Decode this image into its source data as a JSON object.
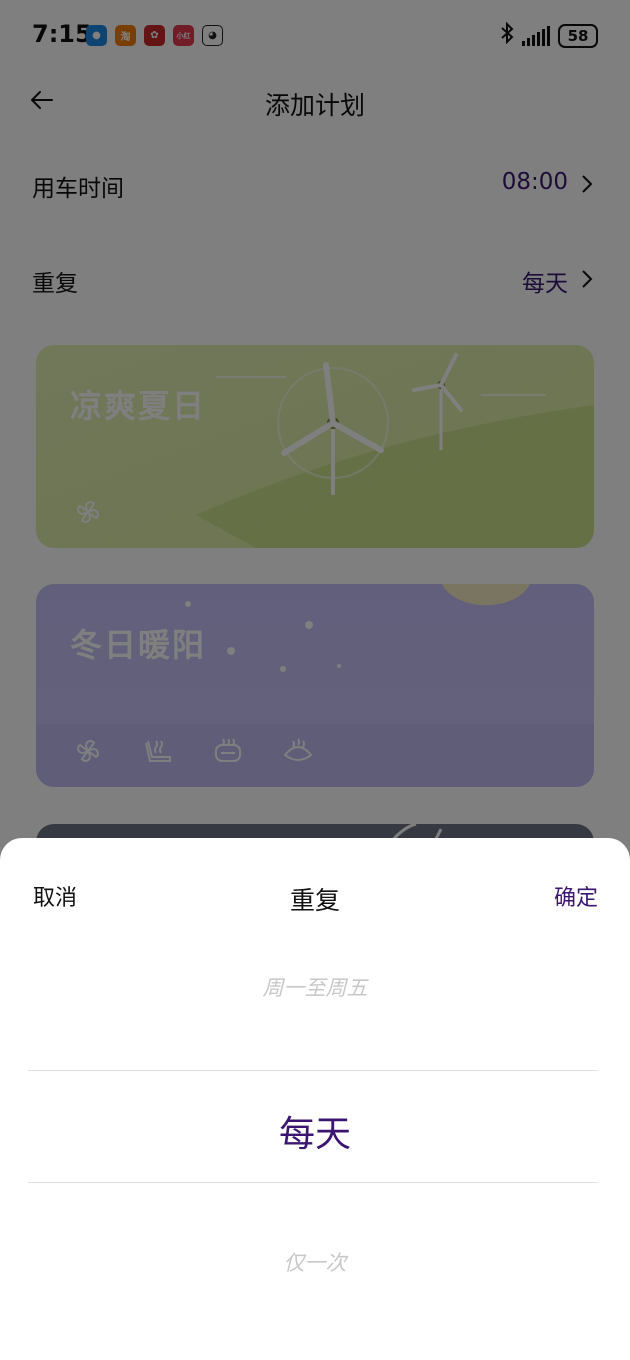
{
  "status_bar": {
    "time": "7:15",
    "battery": "58",
    "apps": [
      {
        "name": "message-app-icon",
        "glyph": "💬",
        "color": "#1e88e5"
      },
      {
        "name": "taobao-app-icon",
        "glyph": "淘",
        "color": "#f57c00"
      },
      {
        "name": "flower-app-icon",
        "glyph": "✿",
        "color": "#d32f2f"
      },
      {
        "name": "xiaohongshu-app-icon",
        "glyph": "小红书",
        "color": "#e53950"
      },
      {
        "name": "qq-app-icon",
        "glyph": "🐧",
        "color": "#ffffff"
      }
    ]
  },
  "header": {
    "title": "添加计划"
  },
  "settings": {
    "time_label": "用车时间",
    "time_value": "08:00",
    "repeat_label": "重复",
    "repeat_value": "每天"
  },
  "cards": {
    "summer_title": "凉爽夏日",
    "winter_title": "冬日暖阳"
  },
  "sheet": {
    "cancel": "取消",
    "title": "重复",
    "confirm": "确定",
    "options": [
      "周一至周五",
      "每天",
      "仅一次"
    ],
    "selected": "每天"
  },
  "colors": {
    "accent": "#3a1670",
    "summer_card": "#d9eaa0",
    "winter_card": "#c3bff8"
  }
}
